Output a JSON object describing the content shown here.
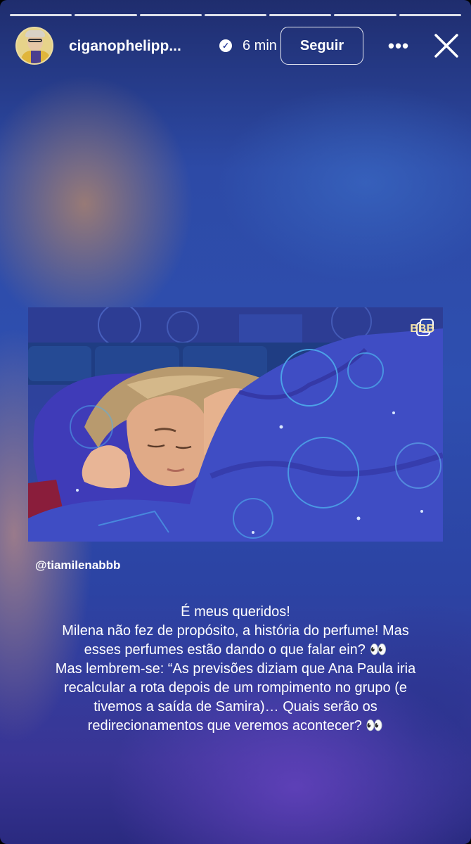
{
  "story": {
    "progress_segments": 7,
    "username": "ciganophelipp...",
    "verified": true,
    "time": "6 min",
    "follow_label": "Seguir",
    "more_label": "•••"
  },
  "media": {
    "watermark": "BBB"
  },
  "mention": "@tiamilenabbb",
  "caption": {
    "line1": "É meus queridos!",
    "line2": "Milena não fez de propósito, a história do perfume! Mas",
    "line3": "esses perfumes estão dando o que falar ein? 👀",
    "line4": "Mas lembrem-se: “As previsões diziam que Ana Paula iria",
    "line5": "recalcular a rota depois de um rompimento no grupo (e",
    "line6": "tivemos a saída de Samira)… Quais serão os",
    "line7": "redirecionamentos que veremos acontecer? 👀"
  },
  "colors": {
    "background_top": "#1f2d6e",
    "background_mid": "#2e4fb0",
    "background_bottom": "#2a2a80",
    "text": "#ffffff"
  }
}
